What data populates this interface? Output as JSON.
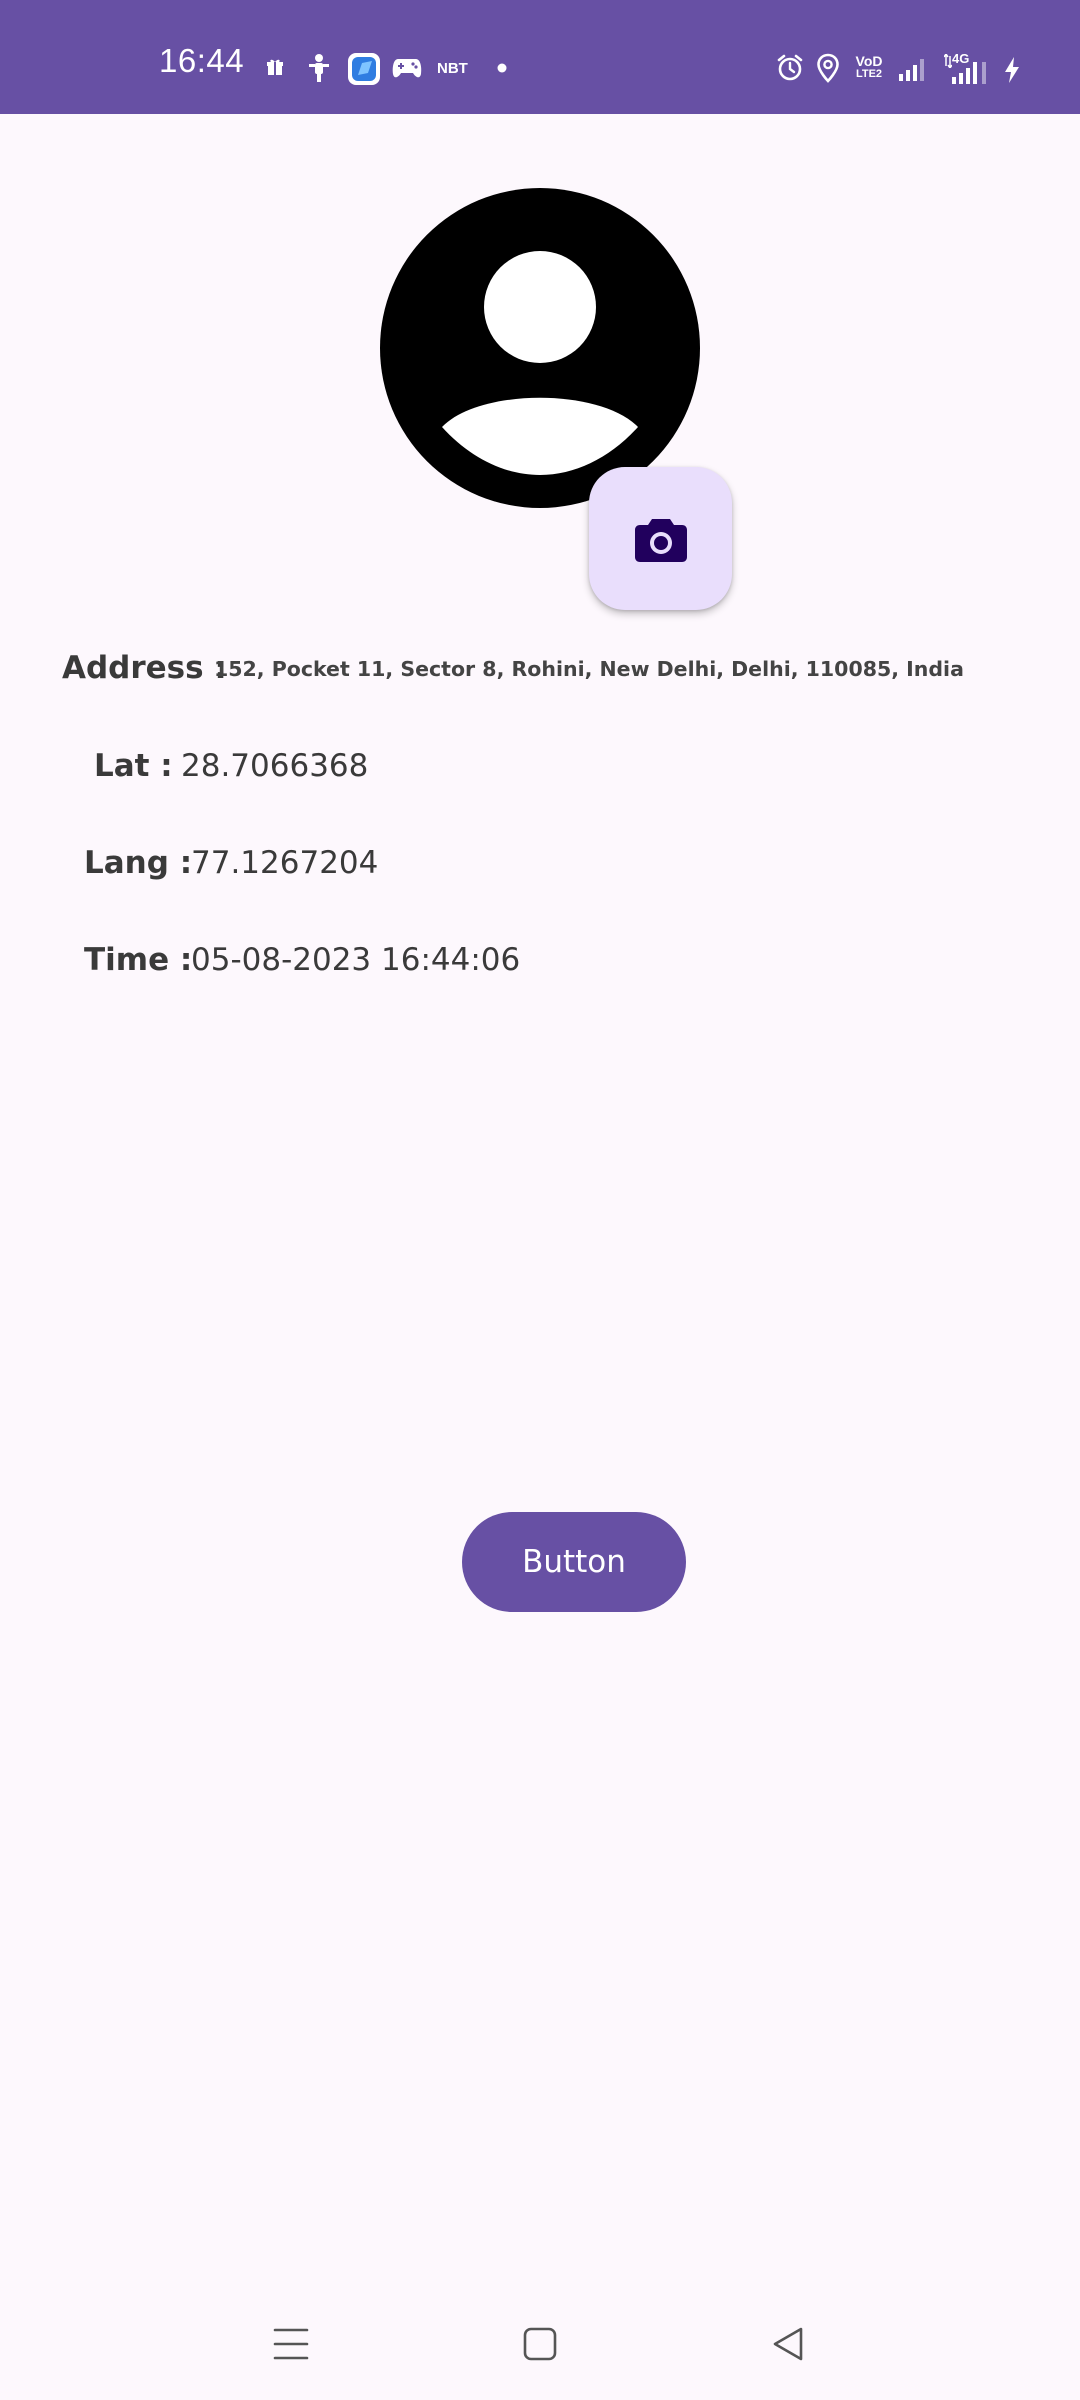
{
  "status_bar": {
    "time": "16:44",
    "news_badge": "NBT",
    "volte_line1": "VoD",
    "volte_line2": "LTE2",
    "network_type": "4G",
    "icons": [
      "gift-icon",
      "scooter-icon",
      "blue-app-icon",
      "gamepad-icon",
      "news-icon",
      "dot-icon",
      "alarm-icon",
      "location-icon",
      "volte-icon",
      "signal-icon",
      "data-signal-icon",
      "charging-icon"
    ]
  },
  "profile": {
    "avatar_icon": "account-circle-icon",
    "camera_icon": "camera-icon"
  },
  "info": {
    "address_label": "Address :",
    "address_value": "152, Pocket 11, Sector 8, Rohini, New Delhi, Delhi, 110085, India",
    "lat_label": "Lat :",
    "lat_value": "28.7066368",
    "lang_label": "Lang :",
    "lang_value": "77.1267204",
    "time_label": "Time :",
    "time_value": "05-08-2023 16:44:06"
  },
  "actions": {
    "button_label": "Button"
  },
  "nav": {
    "icons": [
      "menu-icon",
      "home-icon",
      "back-icon"
    ]
  },
  "colors": {
    "primary": "#6750a4",
    "fab_container": "#e9defc",
    "background": "#fdf8fd",
    "on_fab": "#21005d"
  }
}
